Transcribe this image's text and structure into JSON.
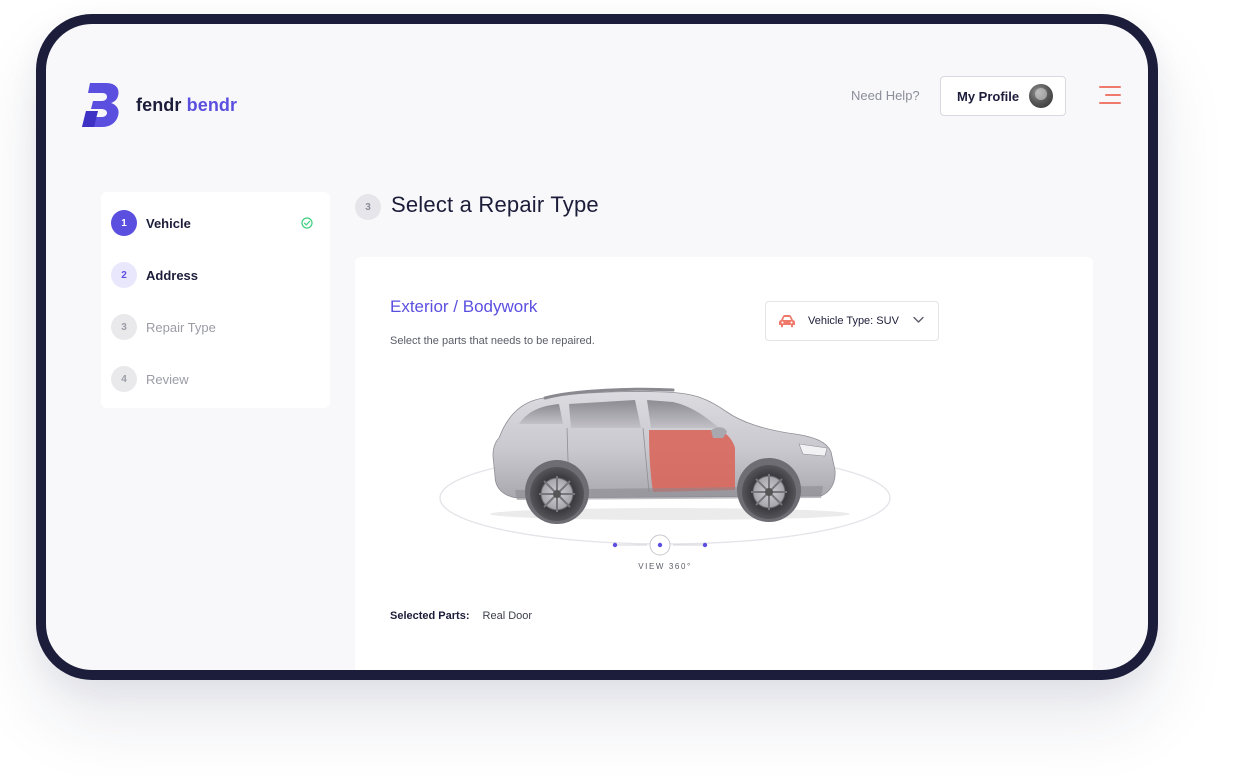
{
  "brand": {
    "name_part1": "fendr",
    "name_part2": "bendr",
    "accent": "#5b4fe0",
    "dark": "#1c1d3a"
  },
  "header": {
    "help_label": "Need Help?",
    "profile_label": "My Profile",
    "menu_icon": "hamburger-icon",
    "menu_color": "#ee7a6c"
  },
  "steps": [
    {
      "num": "1",
      "label": "Vehicle",
      "state": "done"
    },
    {
      "num": "2",
      "label": "Address",
      "state": "current"
    },
    {
      "num": "3",
      "label": "Repair Type",
      "state": "pending"
    },
    {
      "num": "4",
      "label": "Review",
      "state": "pending"
    }
  ],
  "main": {
    "step_num": "3",
    "title": "Select a Repair Type",
    "section_title": "Exterior / Bodywork",
    "section_subtitle": "Select the parts that needs to be repaired.",
    "vehicle_type_label": "Vehicle Type: SUV",
    "view_label": "VIEW 360°",
    "selected_key": "Selected Parts:",
    "selected_value": "Real Door",
    "highlight_color": "#d9655a"
  }
}
